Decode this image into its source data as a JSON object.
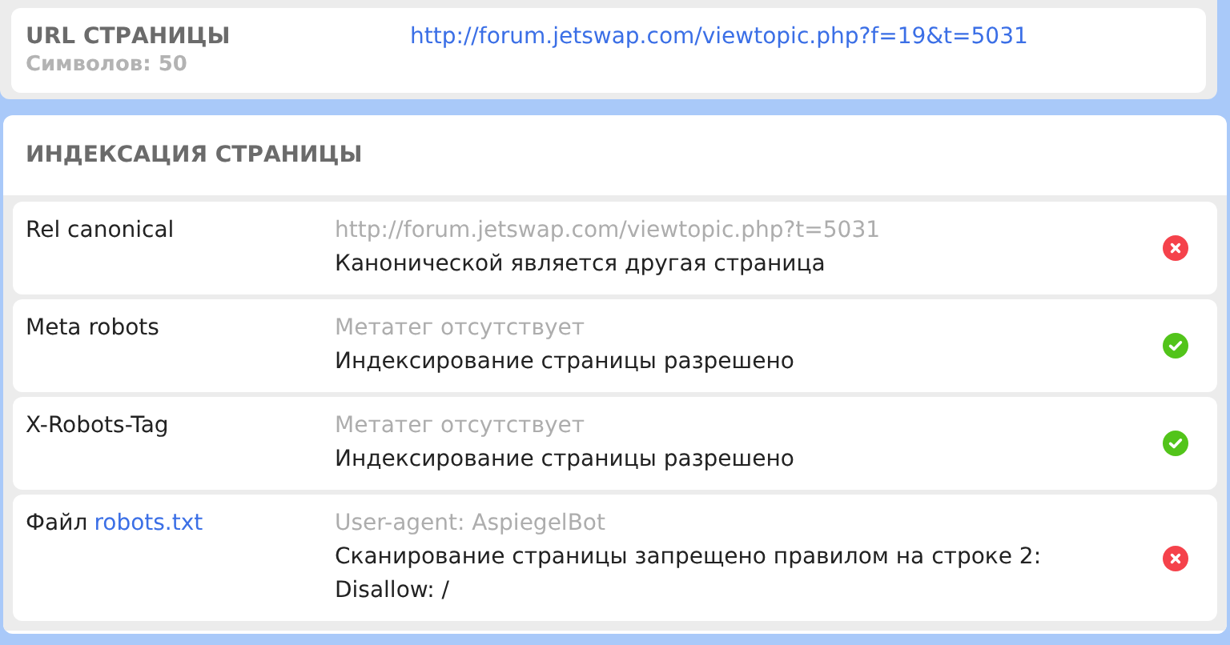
{
  "url_section": {
    "title": "URL СТРАНИЦЫ",
    "count": "Символов: 50",
    "url": "http://forum.jetswap.com/viewtopic.php?f=19&t=5031"
  },
  "indexing": {
    "title": "ИНДЕКСАЦИЯ СТРАНИЦЫ",
    "rows": [
      {
        "label": "Rel canonical",
        "value": "http://forum.jetswap.com/viewtopic.php?t=5031",
        "message": "Канонической является другая страница",
        "passed": false
      },
      {
        "label": "Meta robots",
        "value": "Метатег отсутствует",
        "message": "Индексирование страницы разрешено",
        "passed": true
      },
      {
        "label": "X-Robots-Tag",
        "value": "Метатег отсутствует",
        "message": "Индексирование страницы разрешено",
        "passed": true
      },
      {
        "label": "Файл",
        "label_link": "robots.txt",
        "value": "User-agent: AspiegelBot",
        "message": "Сканирование страницы запрещено правилом на строке 2: Disallow: /",
        "passed": false
      }
    ]
  }
}
